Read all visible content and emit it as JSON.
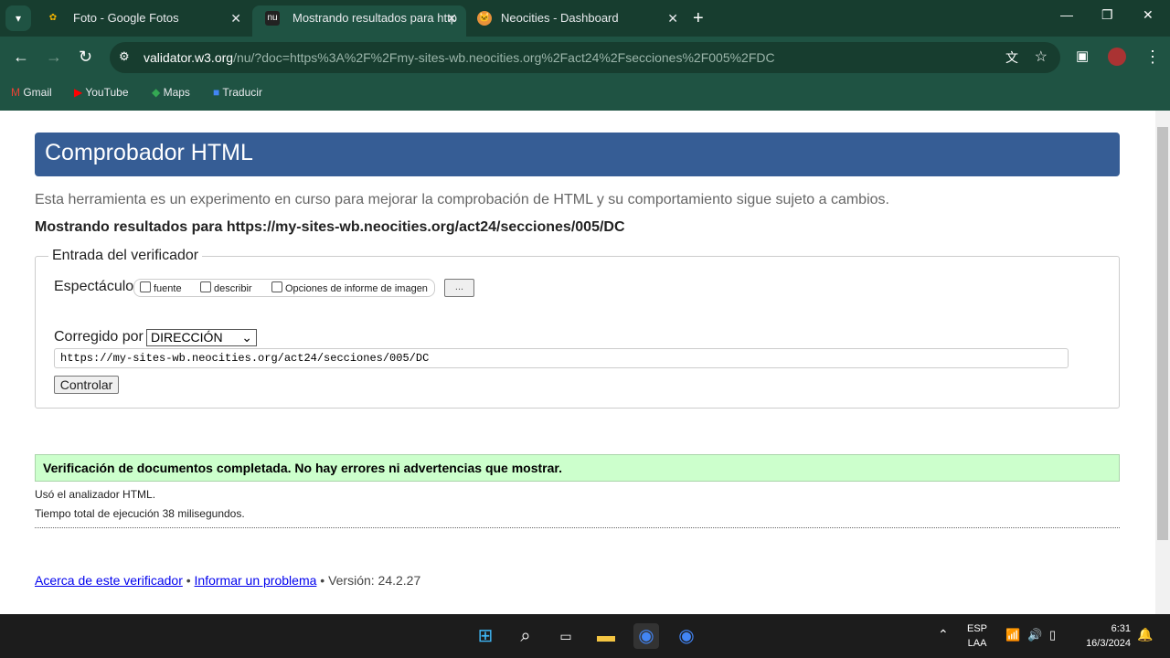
{
  "browser": {
    "tabs": [
      {
        "title": "Foto - Google Fotos",
        "icon": "google-photos-icon"
      },
      {
        "title": "Mostrando resultados para http",
        "icon": "nu-validator-icon"
      },
      {
        "title": "Neocities - Dashboard",
        "icon": "neocities-cat-icon"
      }
    ],
    "url_host": "validator.w3.org",
    "url_path": "/nu/?doc=https%3A%2F%2Fmy-sites-wb.neocities.org%2Fact24%2Fsecciones%2F005%2FDC",
    "bookmarks": [
      "Gmail",
      "YouTube",
      "Maps",
      "Traducir"
    ]
  },
  "page": {
    "title": "Comprobador HTML",
    "intro": "Esta herramienta es un experimento en curso para mejorar la comprobación de HTML y su comportamiento sigue sujeto a cambios.",
    "showing": "Mostrando resultados para https://my-sites-wb.neocities.org/act24/secciones/005/DC",
    "legend": "Entrada del verificador",
    "show_label": "Espectáculo",
    "options": [
      "fuente",
      "describir",
      "Opciones de informe de imagen"
    ],
    "more_button": "...",
    "checked_by_label": "Corregido por",
    "checked_by_value": "DIRECCIÓN",
    "url_value": "https://my-sites-wb.neocities.org/act24/secciones/005/DC",
    "check_button": "Controlar",
    "result": "Verificación de documentos completada. No hay errores ni advertencias que mostrar.",
    "parser": "Usó el analizador HTML.",
    "time": "Tiempo total de ejecución 38 milisegundos.",
    "about_link": "Acerca de este verificador",
    "report_link": "Informar un problema",
    "version": "• Versión: 24.2.27",
    "sep": "•"
  },
  "taskbar": {
    "lang1": "ESP",
    "lang2": "LAA",
    "time": "6:31",
    "date": "16/3/2024"
  },
  "colors": {
    "header": "#365d95",
    "success": "#ccffcc",
    "chrome": "#1f5343"
  }
}
